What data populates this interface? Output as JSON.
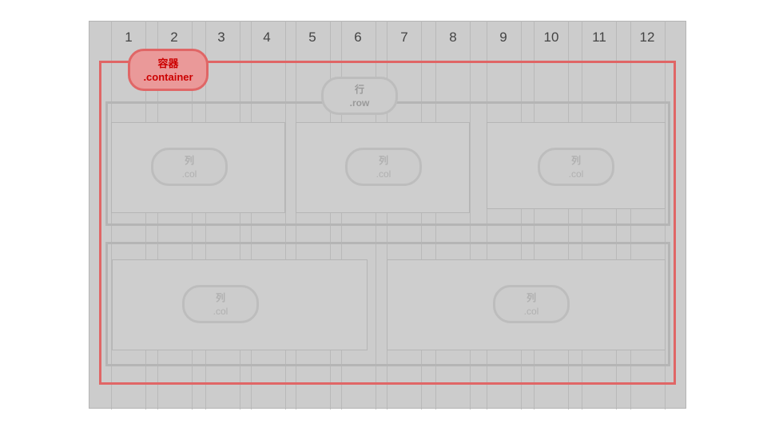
{
  "grid": {
    "columns": [
      "1",
      "2",
      "3",
      "4",
      "5",
      "6",
      "7",
      "8",
      "9",
      "10",
      "11",
      "12"
    ]
  },
  "container": {
    "label_cn": "容器",
    "label_class": ".container",
    "color": "#e06666"
  },
  "rows": [
    {
      "label_cn": "行",
      "label_class": ".row",
      "cols": [
        {
          "label_cn": "列",
          "label_class": ".col"
        },
        {
          "label_cn": "列",
          "label_class": ".col"
        },
        {
          "label_cn": "列",
          "label_class": ".col"
        }
      ]
    },
    {
      "cols": [
        {
          "label_cn": "列",
          "label_class": ".col"
        },
        {
          "label_cn": "列",
          "label_class": ".col"
        }
      ]
    }
  ]
}
